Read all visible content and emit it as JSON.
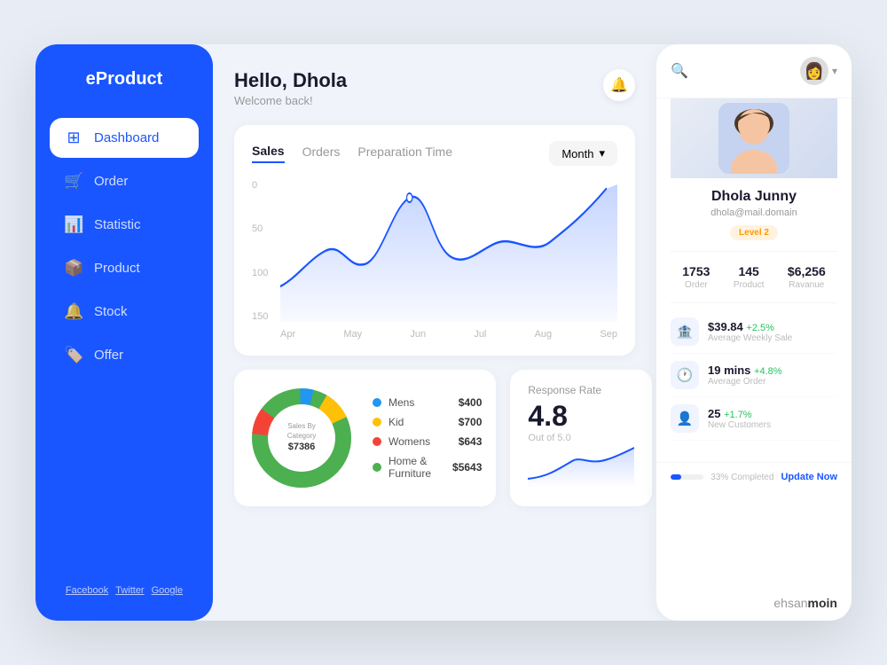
{
  "app": {
    "logo": "eProduct",
    "watermark": "ehsanmoin"
  },
  "sidebar": {
    "logo": "eProduct",
    "nav_items": [
      {
        "id": "dashboard",
        "label": "Dashboard",
        "icon": "⊞",
        "active": true
      },
      {
        "id": "order",
        "label": "Order",
        "icon": "🛒",
        "active": false
      },
      {
        "id": "statistic",
        "label": "Statistic",
        "icon": "📊",
        "active": false
      },
      {
        "id": "product",
        "label": "Product",
        "icon": "📦",
        "active": false
      },
      {
        "id": "stock",
        "label": "Stock",
        "icon": "🔔",
        "active": false
      },
      {
        "id": "offer",
        "label": "Offer",
        "icon": "🏷️",
        "active": false
      }
    ],
    "footer_links": [
      "Facebook",
      "Twitter",
      "Google"
    ]
  },
  "header": {
    "greeting": "Hello, Dhola",
    "subtitle": "Welcome back!",
    "bell_icon": "🔔"
  },
  "chart": {
    "tabs": [
      "Sales",
      "Orders",
      "Preparation Time"
    ],
    "active_tab": "Sales",
    "filter": "Month",
    "y_labels": [
      "0",
      "50",
      "100",
      "150"
    ],
    "x_labels": [
      "Apr",
      "May",
      "Jun",
      "Jul",
      "Aug",
      "Sep"
    ]
  },
  "pie": {
    "title": "Sales By Category",
    "total": "$7386",
    "categories": [
      {
        "name": "Mens",
        "value": "$400",
        "color": "#2196F3"
      },
      {
        "name": "Kid",
        "value": "$700",
        "color": "#FFC107"
      },
      {
        "name": "Womens",
        "value": "$643",
        "color": "#F44336"
      },
      {
        "name": "Home & Furniture",
        "value": "$5643",
        "color": "#4CAF50"
      }
    ]
  },
  "response_rate": {
    "title": "Response Rate",
    "value": "4.8",
    "subtitle": "Out of 5.0"
  },
  "right_panel": {
    "search_placeholder": "Search...",
    "profile": {
      "name": "Dhola Junny",
      "email": "dhola@mail.domain",
      "badge": "Level 2"
    },
    "stats": [
      {
        "value": "1753",
        "label": "Order"
      },
      {
        "value": "145",
        "label": "Product"
      },
      {
        "value": "$6,256",
        "label": "Ravanue"
      }
    ],
    "metrics": [
      {
        "icon": "🏦",
        "value": "$39.84",
        "change": "+2.5%",
        "desc": "Average Weekly Sale"
      },
      {
        "icon": "🕐",
        "value": "19 mins",
        "change": "+4.8%",
        "desc": "Average Order"
      },
      {
        "icon": "👤",
        "value": "25",
        "change": "+1.7%",
        "desc": "New Customers"
      }
    ],
    "progress": {
      "percent": 33,
      "label": "33% Completed",
      "button": "Update Now"
    }
  }
}
